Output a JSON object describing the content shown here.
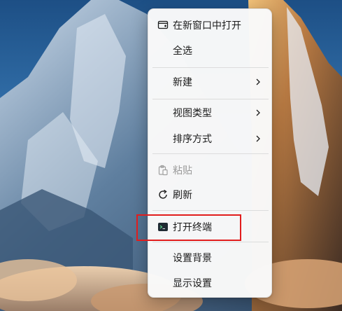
{
  "menu": {
    "items": [
      {
        "label": "在新窗口中打开",
        "icon": "new-window-icon"
      },
      {
        "label": "全选"
      },
      {
        "label": "新建",
        "icon": "chevron-right-icon"
      },
      {
        "label": "视图类型",
        "icon": "chevron-right-icon"
      },
      {
        "label": "排序方式",
        "icon": "chevron-right-icon"
      },
      {
        "label": "粘贴",
        "icon": "paste-icon",
        "disabled": true
      },
      {
        "label": "刷新",
        "icon": "refresh-icon"
      },
      {
        "label": "打开终端",
        "icon": "terminal-icon"
      },
      {
        "label": "设置背景"
      },
      {
        "label": "显示设置"
      }
    ]
  },
  "colors": {
    "annotation_border": "#e11d1d",
    "menu_background": "#f9f9f9",
    "wallpaper_sky": "#2c6aa6"
  }
}
